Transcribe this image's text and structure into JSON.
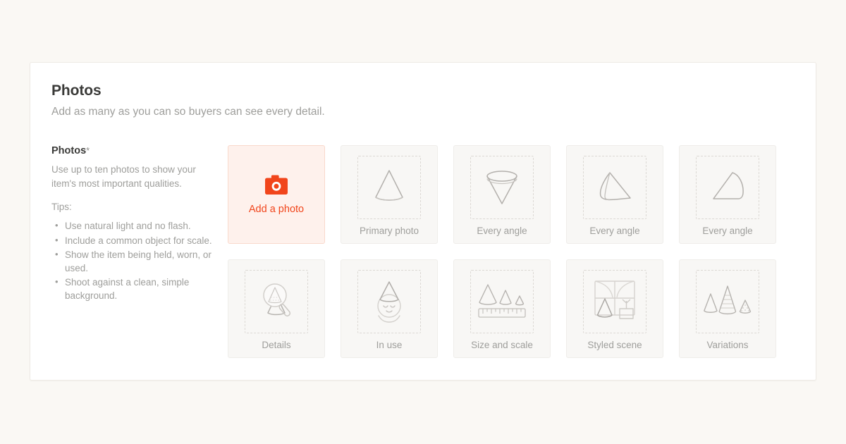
{
  "page": {
    "background_color": "#faf8f4",
    "card_background": "#ffffff"
  },
  "section": {
    "title": "Photos",
    "subtitle": "Add as many as you can so buyers can see every detail."
  },
  "field": {
    "label": "Photos",
    "required_marker": "*",
    "help_text": "Use up to ten photos to show your item's most important qualities.",
    "tips_label": "Tips:",
    "tips": [
      "Use natural light and no flash.",
      "Include a common object for scale.",
      "Show the item being held, worn, or used.",
      "Shoot against a clean, simple background."
    ]
  },
  "uploader": {
    "accent_color": "#f1451b",
    "add_tile": {
      "label": "Add a photo",
      "icon": "camera-icon",
      "background": "#fef1ec",
      "border": "#f9d9cc"
    },
    "tiles": [
      {
        "label": "Primary photo",
        "icon": "cone-upright-icon"
      },
      {
        "label": "Every angle",
        "icon": "cone-inverted-icon"
      },
      {
        "label": "Every angle",
        "icon": "cone-tilted-icon"
      },
      {
        "label": "Every angle",
        "icon": "cone-on-side-icon"
      },
      {
        "label": "Details",
        "icon": "magnifier-cone-icon"
      },
      {
        "label": "In use",
        "icon": "face-wearing-cone-icon"
      },
      {
        "label": "Size and scale",
        "icon": "cones-with-ruler-icon"
      },
      {
        "label": "Styled scene",
        "icon": "window-cone-plant-icon"
      },
      {
        "label": "Variations",
        "icon": "three-textured-cones-icon"
      }
    ]
  }
}
